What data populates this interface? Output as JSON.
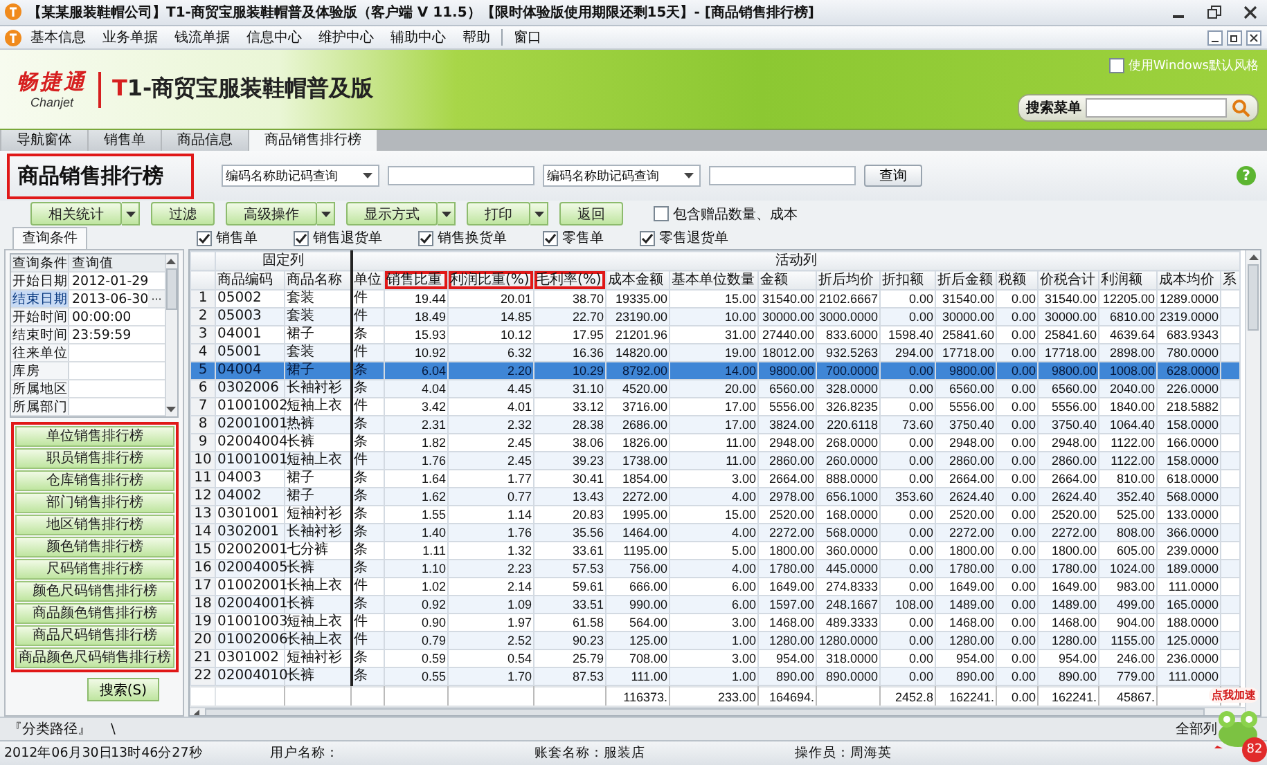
{
  "window": {
    "title": "【某某服装鞋帽公司】T1-商贸宝服装鞋帽普及体验版（客户端 V 11.5）【限时体验版使用期限还剩15天】- [商品销售排行榜]"
  },
  "menu": [
    "基本信息",
    "业务单据",
    "钱流单据",
    "信息中心",
    "维护中心",
    "辅助中心",
    "帮助",
    "窗口"
  ],
  "banner": {
    "brand": "畅捷通",
    "brand_latin": "Chanjet",
    "product_mark": "T",
    "product_rest": "1-商贸宝服装鞋帽普及版",
    "style_checkbox": {
      "label": "使用Windows默认风格",
      "checked": false
    },
    "menu_search": {
      "label": "搜索菜单"
    }
  },
  "tabs": [
    {
      "label": "导航窗体",
      "selected": false
    },
    {
      "label": "销售单",
      "selected": false
    },
    {
      "label": "商品信息",
      "selected": false
    },
    {
      "label": "商品销售排行榜",
      "selected": true
    }
  ],
  "header": {
    "title": {
      "text": "商品销售排行榜",
      "highlighted": true
    },
    "combos": [
      {
        "value": "编码名称助记码查询"
      },
      {
        "value": "编码名称助记码查询"
      }
    ],
    "query_button": "查询",
    "help": "?"
  },
  "toolbar": [
    {
      "label": "相关统计",
      "dropdown": true
    },
    {
      "label": "过滤",
      "dropdown": false
    },
    {
      "label": "高级操作",
      "dropdown": true
    },
    {
      "label": "显示方式",
      "dropdown": true
    },
    {
      "label": "打印",
      "dropdown": true
    },
    {
      "label": "返回",
      "dropdown": false
    }
  ],
  "gift_checkbox": {
    "label": "包含赠品数量、成本",
    "checked": false
  },
  "left_panel": {
    "tab": "查询条件",
    "grid_columns": [
      "查询条件",
      "查询值"
    ],
    "rows": [
      {
        "label": "开始日期",
        "value": "2012-01-29",
        "selected": false
      },
      {
        "label": "结束日期",
        "value": "2013-06-30",
        "button": "···",
        "selected": true
      },
      {
        "label": "开始时间",
        "value": "00:00:00",
        "selected": false
      },
      {
        "label": "结束时间",
        "value": "23:59:59",
        "selected": false
      },
      {
        "label": "往来单位",
        "selected": false
      },
      {
        "label": "库房",
        "selected": false
      },
      {
        "label": "所属地区",
        "selected": false
      },
      {
        "label": "所属部门",
        "selected": false
      }
    ],
    "report_panel": {
      "highlighted": true,
      "buttons": [
        "单位销售排行榜",
        "职员销售排行榜",
        "仓库销售排行榜",
        "部门销售排行榜",
        "地区销售排行榜",
        "颜色销售排行榜",
        "尺码销售排行榜",
        "颜色尺码销售排行榜",
        "商品颜色销售排行榜",
        "商品尺码销售排行榜",
        "商品颜色尺码销售排行榜"
      ]
    },
    "search_button": "搜索(S)"
  },
  "bill_filters": [
    {
      "label": "销售单",
      "checked": true
    },
    {
      "label": "销售退货单",
      "checked": true
    },
    {
      "label": "销售换货单",
      "checked": true
    },
    {
      "label": "零售单",
      "checked": true
    },
    {
      "label": "零售退货单",
      "checked": true
    }
  ],
  "table": {
    "column_groups": [
      {
        "label": "固定列",
        "columns": [
          {
            "label": "商品编码",
            "kind": "text",
            "highlighted": false
          },
          {
            "label": "商品名称",
            "kind": "text",
            "highlighted": false
          }
        ]
      },
      {
        "label": "活动列",
        "columns": [
          {
            "label": "单位",
            "kind": "text",
            "highlighted": false
          },
          {
            "label": "销售比重",
            "kind": "number",
            "highlighted": true
          },
          {
            "label": "利润比重(%)",
            "kind": "number",
            "highlighted": true
          },
          {
            "label": "毛利率(%)",
            "kind": "number",
            "highlighted": true
          },
          {
            "label": "成本金额",
            "kind": "number",
            "highlighted": false,
            "total": "116373."
          },
          {
            "label": "基本单位数量",
            "kind": "number",
            "highlighted": false,
            "total": "233.00"
          },
          {
            "label": "金额",
            "kind": "number",
            "highlighted": false,
            "total": "164694."
          },
          {
            "label": "折后均价",
            "kind": "number",
            "highlighted": false
          },
          {
            "label": "折扣额",
            "kind": "number",
            "highlighted": false,
            "total": "2452.8"
          },
          {
            "label": "折后金额",
            "kind": "number",
            "highlighted": false,
            "total": "162241."
          },
          {
            "label": "税额",
            "kind": "number",
            "highlighted": false,
            "total": "0.00"
          },
          {
            "label": "价税合计",
            "kind": "number",
            "highlighted": false,
            "total": "162241."
          },
          {
            "label": "利润额",
            "kind": "number",
            "highlighted": false,
            "total": "45867."
          },
          {
            "label": "成本均价",
            "kind": "number",
            "highlighted": false
          },
          {
            "label": "系",
            "kind": "text",
            "highlighted": false
          }
        ]
      }
    ],
    "rows": [
      {
        "no": "1",
        "selected": false,
        "cells": [
          "05002",
          "套装",
          "件",
          "19.44",
          "20.01",
          "38.70",
          "19335.00",
          "15.00",
          "31540.00",
          "2102.6667",
          "0.00",
          "31540.00",
          "0.00",
          "31540.00",
          "12205.00",
          "1289.0000"
        ]
      },
      {
        "no": "2",
        "selected": false,
        "cells": [
          "05003",
          "套装",
          "件",
          "18.49",
          "14.85",
          "22.70",
          "23190.00",
          "10.00",
          "30000.00",
          "3000.0000",
          "0.00",
          "30000.00",
          "0.00",
          "30000.00",
          "6810.00",
          "2319.0000"
        ]
      },
      {
        "no": "3",
        "selected": false,
        "cells": [
          "04001",
          "裙子",
          "条",
          "15.93",
          "10.12",
          "17.95",
          "21201.96",
          "31.00",
          "27440.00",
          "833.6000",
          "1598.40",
          "25841.60",
          "0.00",
          "25841.60",
          "4639.64",
          "683.9343"
        ]
      },
      {
        "no": "4",
        "selected": false,
        "cells": [
          "05001",
          "套装",
          "件",
          "10.92",
          "6.32",
          "16.36",
          "14820.00",
          "19.00",
          "18012.00",
          "932.5263",
          "294.00",
          "17718.00",
          "0.00",
          "17718.00",
          "2898.00",
          "780.0000"
        ]
      },
      {
        "no": "5",
        "selected": true,
        "cells": [
          "04004",
          "裙子",
          "条",
          "6.04",
          "2.20",
          "10.29",
          "8792.00",
          "14.00",
          "9800.00",
          "700.0000",
          "0.00",
          "9800.00",
          "0.00",
          "9800.00",
          "1008.00",
          "628.0000"
        ]
      },
      {
        "no": "6",
        "selected": false,
        "cells": [
          "0302006",
          "长袖衬衫",
          "条",
          "4.04",
          "4.45",
          "31.10",
          "4520.00",
          "20.00",
          "6560.00",
          "328.0000",
          "0.00",
          "6560.00",
          "0.00",
          "6560.00",
          "2040.00",
          "226.0000"
        ]
      },
      {
        "no": "7",
        "selected": false,
        "cells": [
          "01001002",
          "短袖上衣",
          "件",
          "3.42",
          "4.01",
          "33.12",
          "3716.00",
          "17.00",
          "5556.00",
          "326.8235",
          "0.00",
          "5556.00",
          "0.00",
          "5556.00",
          "1840.00",
          "218.5882"
        ]
      },
      {
        "no": "8",
        "selected": false,
        "cells": [
          "02001001",
          "热裤",
          "条",
          "2.31",
          "2.32",
          "28.38",
          "2686.00",
          "17.00",
          "3824.00",
          "220.6118",
          "73.60",
          "3750.40",
          "0.00",
          "3750.40",
          "1064.40",
          "158.0000"
        ]
      },
      {
        "no": "9",
        "selected": false,
        "cells": [
          "02004004",
          "长裤",
          "条",
          "1.82",
          "2.45",
          "38.06",
          "1826.00",
          "11.00",
          "2948.00",
          "268.0000",
          "0.00",
          "2948.00",
          "0.00",
          "2948.00",
          "1122.00",
          "166.0000"
        ]
      },
      {
        "no": "10",
        "selected": false,
        "cells": [
          "01001001",
          "短袖上衣",
          "件",
          "1.76",
          "2.45",
          "39.23",
          "1738.00",
          "11.00",
          "2860.00",
          "260.0000",
          "0.00",
          "2860.00",
          "0.00",
          "2860.00",
          "1122.00",
          "158.0000"
        ]
      },
      {
        "no": "11",
        "selected": false,
        "cells": [
          "04003",
          "裙子",
          "条",
          "1.64",
          "1.77",
          "30.41",
          "1854.00",
          "3.00",
          "2664.00",
          "888.0000",
          "0.00",
          "2664.00",
          "0.00",
          "2664.00",
          "810.00",
          "618.0000"
        ]
      },
      {
        "no": "12",
        "selected": false,
        "cells": [
          "04002",
          "裙子",
          "条",
          "1.62",
          "0.77",
          "13.43",
          "2272.00",
          "4.00",
          "2978.00",
          "656.1000",
          "353.60",
          "2624.40",
          "0.00",
          "2624.40",
          "352.40",
          "568.0000"
        ]
      },
      {
        "no": "13",
        "selected": false,
        "cells": [
          "0301001",
          "短袖衬衫",
          "条",
          "1.55",
          "1.14",
          "20.83",
          "1995.00",
          "15.00",
          "2520.00",
          "168.0000",
          "0.00",
          "2520.00",
          "0.00",
          "2520.00",
          "525.00",
          "133.0000"
        ]
      },
      {
        "no": "14",
        "selected": false,
        "cells": [
          "0302001",
          "长袖衬衫",
          "条",
          "1.40",
          "1.76",
          "35.56",
          "1464.00",
          "4.00",
          "2272.00",
          "568.0000",
          "0.00",
          "2272.00",
          "0.00",
          "2272.00",
          "808.00",
          "366.0000"
        ]
      },
      {
        "no": "15",
        "selected": false,
        "cells": [
          "02002001",
          "七分裤",
          "条",
          "1.11",
          "1.32",
          "33.61",
          "1195.00",
          "5.00",
          "1800.00",
          "360.0000",
          "0.00",
          "1800.00",
          "0.00",
          "1800.00",
          "605.00",
          "239.0000"
        ]
      },
      {
        "no": "16",
        "selected": false,
        "cells": [
          "02004005",
          "长裤",
          "条",
          "1.10",
          "2.23",
          "57.53",
          "756.00",
          "4.00",
          "1780.00",
          "445.0000",
          "0.00",
          "1780.00",
          "0.00",
          "1780.00",
          "1024.00",
          "189.0000"
        ]
      },
      {
        "no": "17",
        "selected": false,
        "cells": [
          "01002001",
          "长袖上衣",
          "件",
          "1.02",
          "2.14",
          "59.61",
          "666.00",
          "6.00",
          "1649.00",
          "274.8333",
          "0.00",
          "1649.00",
          "0.00",
          "1649.00",
          "983.00",
          "111.0000"
        ]
      },
      {
        "no": "18",
        "selected": false,
        "cells": [
          "02004001",
          "长裤",
          "条",
          "0.92",
          "1.09",
          "33.51",
          "990.00",
          "6.00",
          "1597.00",
          "248.1667",
          "108.00",
          "1489.00",
          "0.00",
          "1489.00",
          "499.00",
          "165.0000"
        ]
      },
      {
        "no": "19",
        "selected": false,
        "cells": [
          "01001003",
          "短袖上衣",
          "件",
          "0.90",
          "1.97",
          "61.58",
          "564.00",
          "3.00",
          "1468.00",
          "489.3333",
          "0.00",
          "1468.00",
          "0.00",
          "1468.00",
          "904.00",
          "188.0000"
        ]
      },
      {
        "no": "20",
        "selected": false,
        "cells": [
          "01002006",
          "长袖上衣",
          "件",
          "0.79",
          "2.52",
          "90.23",
          "125.00",
          "1.00",
          "1280.00",
          "1280.0000",
          "0.00",
          "1280.00",
          "0.00",
          "1280.00",
          "1155.00",
          "125.0000"
        ]
      },
      {
        "no": "21",
        "selected": false,
        "cells": [
          "0301002",
          "短袖衬衫",
          "条",
          "0.59",
          "0.54",
          "25.79",
          "708.00",
          "3.00",
          "954.00",
          "318.0000",
          "0.00",
          "954.00",
          "0.00",
          "954.00",
          "246.00",
          "236.0000"
        ]
      },
      {
        "no": "22",
        "selected": false,
        "cells": [
          "02004010",
          "长裤",
          "条",
          "0.55",
          "1.70",
          "87.53",
          "111.00",
          "1.00",
          "890.00",
          "890.0000",
          "0.00",
          "890.00",
          "0.00",
          "890.00",
          "779.00",
          "111.0000"
        ]
      }
    ]
  },
  "path_bar": {
    "label": "『分类路径』",
    "path": "\\",
    "right": "全部列"
  },
  "speed_widget": {
    "label": "点我加速",
    "badge": "82"
  },
  "status_bar": [
    "2012年06月30日",
    "13时46分27秒",
    "用户名称：",
    "账套名称：服装店",
    "操作员：周海英"
  ]
}
